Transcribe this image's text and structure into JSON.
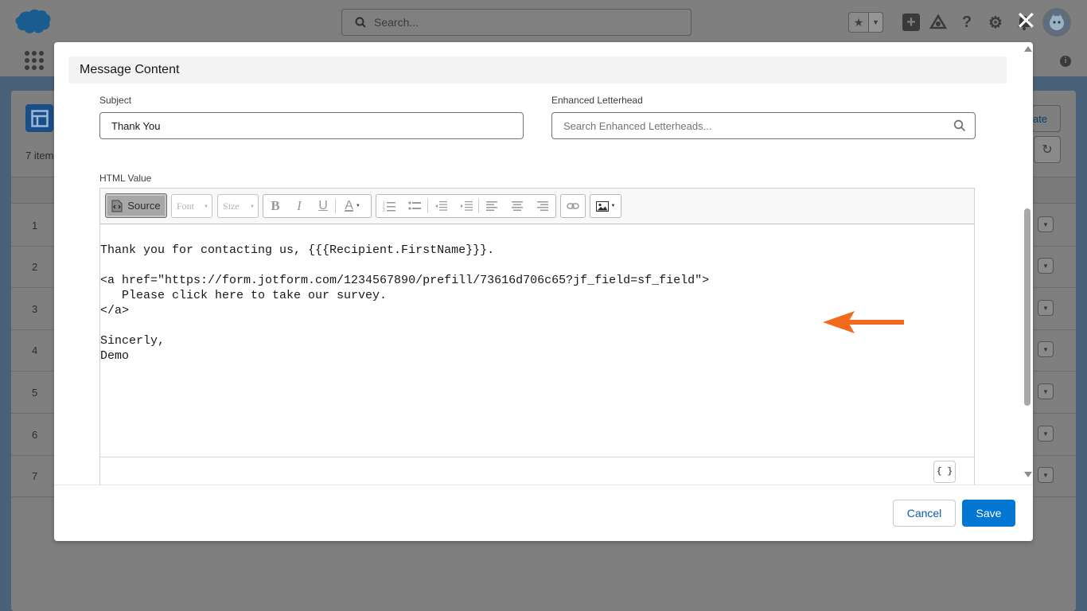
{
  "header": {
    "search_placeholder": "Search...",
    "close_symbol": "✕",
    "favorites_star": "★",
    "favorites_caret": "▼",
    "add_symbol": "+",
    "help_symbol": "?",
    "settings_symbol": "⚙",
    "info_symbol": "i"
  },
  "background": {
    "item_count_label": "7 item",
    "create_button_partial": "ate",
    "refresh_symbol": "↻",
    "rows": [
      "1",
      "2",
      "3",
      "4",
      "5",
      "6",
      "7"
    ],
    "row_menu_symbol": "▼"
  },
  "modal": {
    "section_title": "Message Content",
    "subject_label": "Subject",
    "subject_value": "Thank You",
    "letterhead_label": "Enhanced Letterhead",
    "letterhead_placeholder": "Search Enhanced Letterheads...",
    "html_value_label": "HTML Value",
    "toolbar": {
      "source_label": "Source",
      "font_label": "Font",
      "size_label": "Size",
      "bold": "B",
      "italic": "I",
      "underline": "U",
      "text_color": "A"
    },
    "source_lines": [
      "Thank you for contacting us, {{{Recipient.FirstName}}}.",
      "",
      "<a href=\"https://form.jotform.com/1234567890/prefill/73616d706c65?jf_field=sf_field\">",
      "   Please click here to take our survey.",
      "</a>",
      "",
      "Sincerly,",
      "Demo"
    ],
    "merge_field_symbol": "{ }",
    "cancel_label": "Cancel",
    "save_label": "Save"
  },
  "colors": {
    "brand_blue": "#0176d3",
    "annotation_arrow": "#f26b1d",
    "salesforce_cloud": "#1b96d1"
  }
}
